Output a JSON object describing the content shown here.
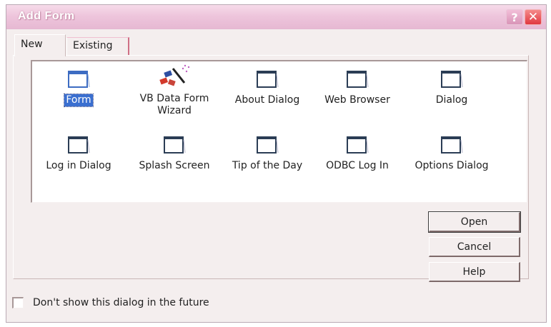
{
  "window": {
    "title": "Add Form",
    "help_glyph": "?",
    "close_glyph": "✕",
    "accent": "#eec5dc",
    "close_color": "#e0373f"
  },
  "tabs": [
    {
      "label": "New",
      "active": true
    },
    {
      "label": "Existing",
      "active": false
    }
  ],
  "items": [
    {
      "label": "Form",
      "icon": "form-icon",
      "selected": true
    },
    {
      "label": "VB Data Form Wizard",
      "icon": "wizard-icon",
      "selected": false
    },
    {
      "label": "About Dialog",
      "icon": "form-icon",
      "selected": false
    },
    {
      "label": "Web Browser",
      "icon": "form-icon",
      "selected": false
    },
    {
      "label": "Dialog",
      "icon": "form-icon",
      "selected": false
    },
    {
      "label": "Log in Dialog",
      "icon": "form-icon",
      "selected": false
    },
    {
      "label": "Splash Screen",
      "icon": "form-icon",
      "selected": false
    },
    {
      "label": "Tip of the Day",
      "icon": "form-icon",
      "selected": false
    },
    {
      "label": "ODBC Log In",
      "icon": "form-icon",
      "selected": false
    },
    {
      "label": "Options Dialog",
      "icon": "form-icon",
      "selected": false
    }
  ],
  "buttons": {
    "open": "Open",
    "cancel": "Cancel",
    "help": "Help"
  },
  "footer": {
    "checkbox_label": "Don't show this dialog in the future",
    "checked": false
  }
}
